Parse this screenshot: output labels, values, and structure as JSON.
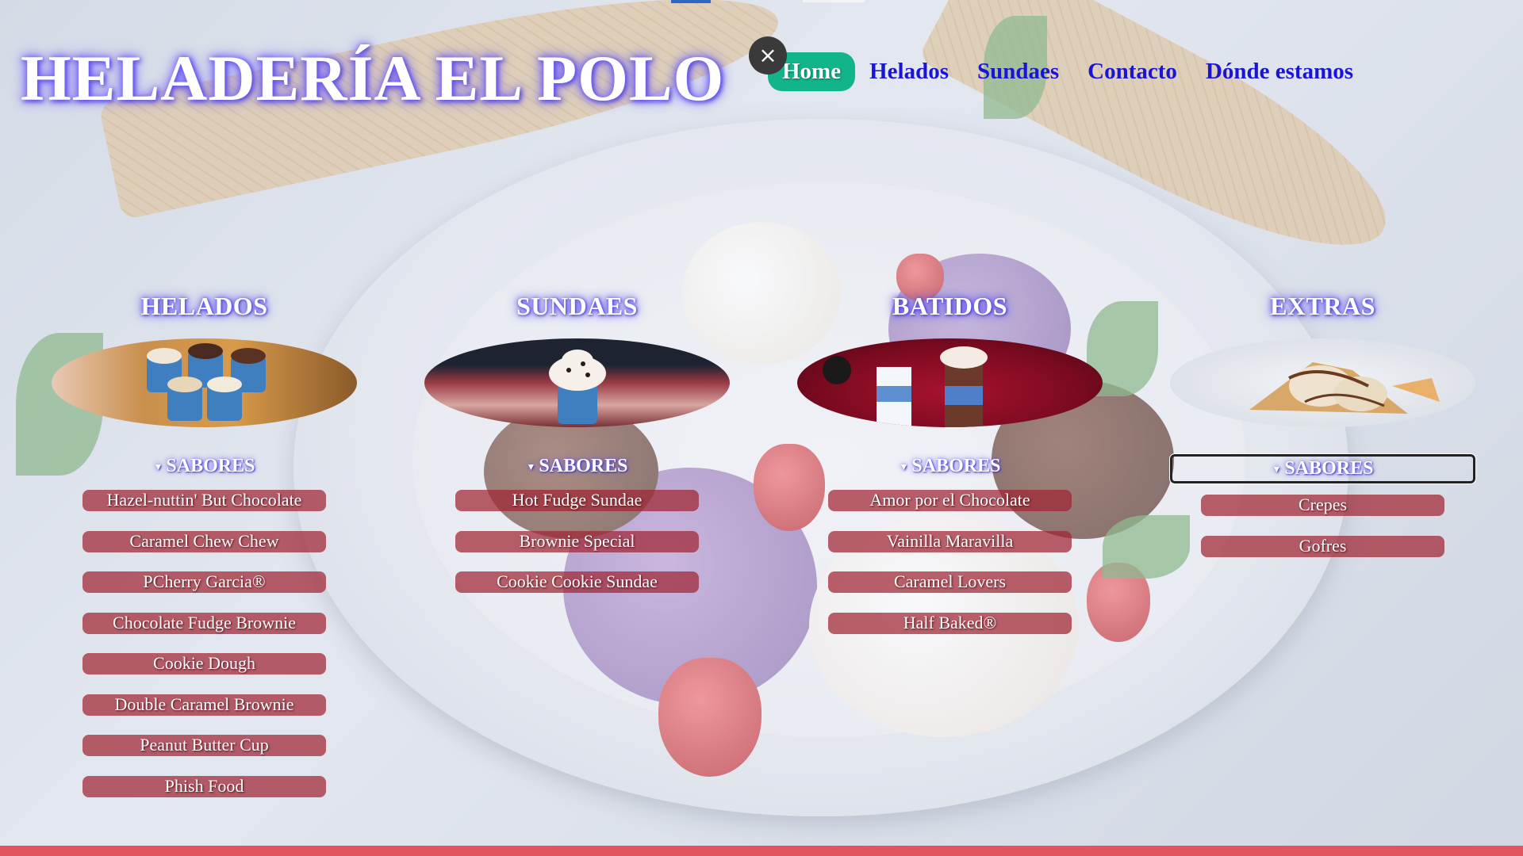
{
  "header": {
    "logo": "HELADERÍA EL POLO",
    "close_icon": "×",
    "nav": [
      {
        "label": "Home",
        "active": true
      },
      {
        "label": "Helados",
        "active": false
      },
      {
        "label": "Sundaes",
        "active": false
      },
      {
        "label": "Contacto",
        "active": false
      },
      {
        "label": "Dónde estamos",
        "active": false
      }
    ]
  },
  "sections": [
    {
      "title": "HELADOS",
      "toggle_icon": "▼",
      "toggle_label": "SABORES",
      "items": [
        "Hazel-nuttin' But Chocolate",
        "Caramel Chew Chew",
        "PCherry Garcia®",
        "Chocolate Fudge Brownie",
        "Cookie Dough",
        "Double Caramel Brownie",
        "Peanut Butter Cup",
        "Phish Food"
      ]
    },
    {
      "title": "SUNDAES",
      "toggle_icon": "▼",
      "toggle_label": "SABORES",
      "items": [
        "Hot Fudge Sundae",
        "Brownie Special",
        "Cookie Cookie Sundae"
      ]
    },
    {
      "title": "BATIDOS",
      "toggle_icon": "▼",
      "toggle_label": "SABORES",
      "items": [
        "Amor por el Chocolate",
        "Vainilla Maravilla",
        "Caramel Lovers",
        "Half Baked®"
      ]
    },
    {
      "title": "EXTRAS",
      "toggle_icon": "▼",
      "toggle_label": "SABORES",
      "items": [
        "Crepes",
        "Gofres"
      ]
    }
  ],
  "colors": {
    "accent_active": "#12b48a",
    "nav_link": "#1a14d6",
    "item_bg": "#a02432",
    "footer_bar": "#e2545e"
  }
}
